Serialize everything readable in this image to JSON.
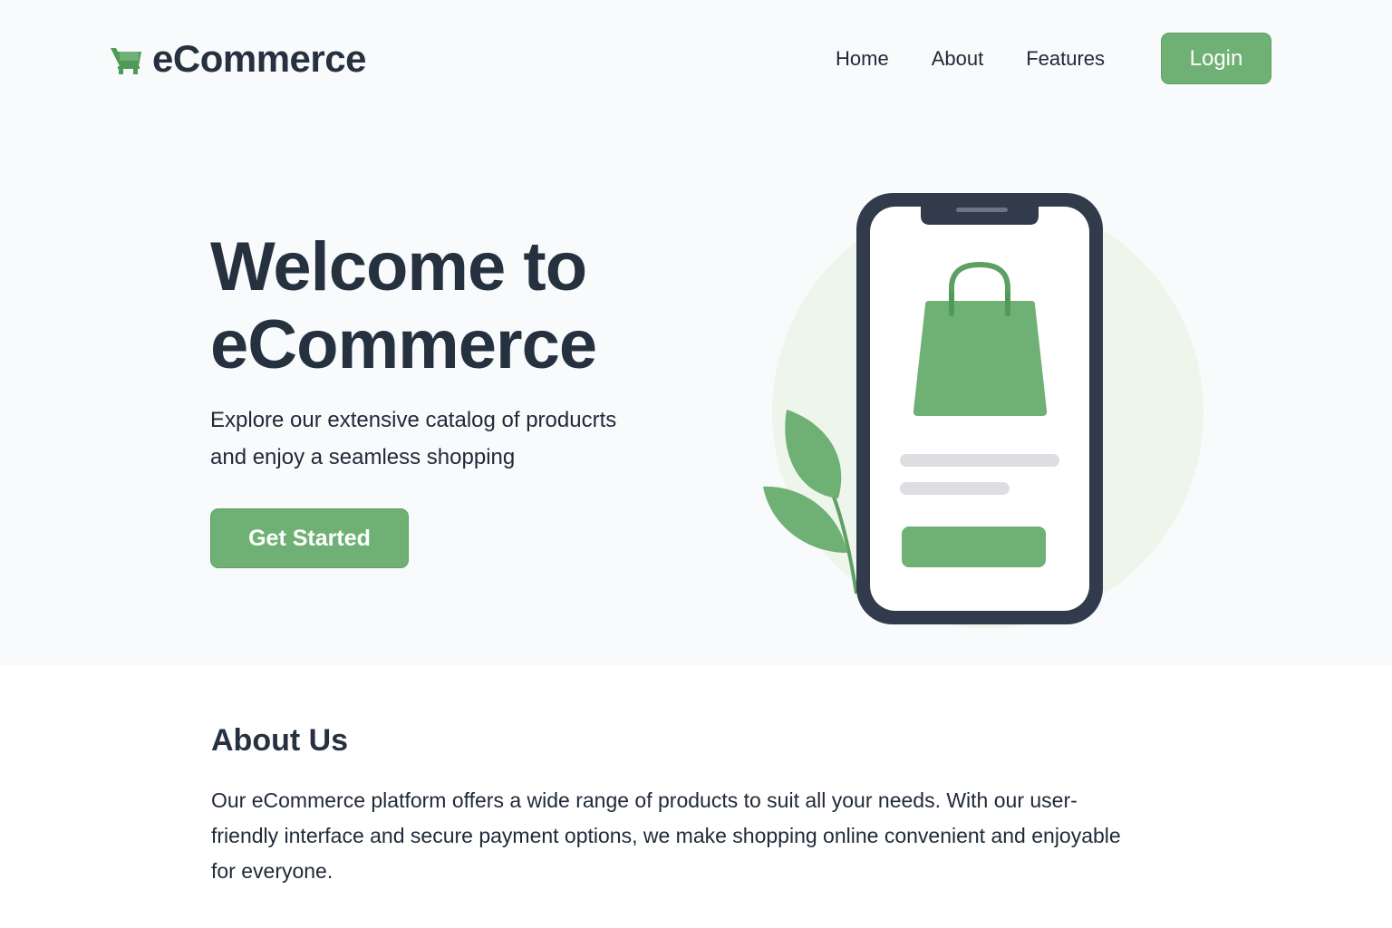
{
  "brand": {
    "name": "eCommerce",
    "icon": "shopping-cart-icon",
    "accent_color": "#6fb174"
  },
  "nav": {
    "links": [
      "Home",
      "About",
      "Features"
    ],
    "login_label": "Login"
  },
  "hero": {
    "title_line1": "Welcome to",
    "title_line2": "eCommerce",
    "subtitle_line1": "Explore our extensive catalog of producrts",
    "subtitle_line2": "and enjoy a seamless shopping",
    "cta_label": "Get Started",
    "illustration": {
      "device": "smartphone-icon",
      "product": "shopping-bag-icon",
      "decoration": "leaf-icon"
    }
  },
  "about": {
    "title": "About Us",
    "body": "Our eCommerce platform offers a wide range of products to suit all your needs. With our user-friendly interface and secure payment options, we make shopping online convenient and enjoyable for everyone."
  }
}
